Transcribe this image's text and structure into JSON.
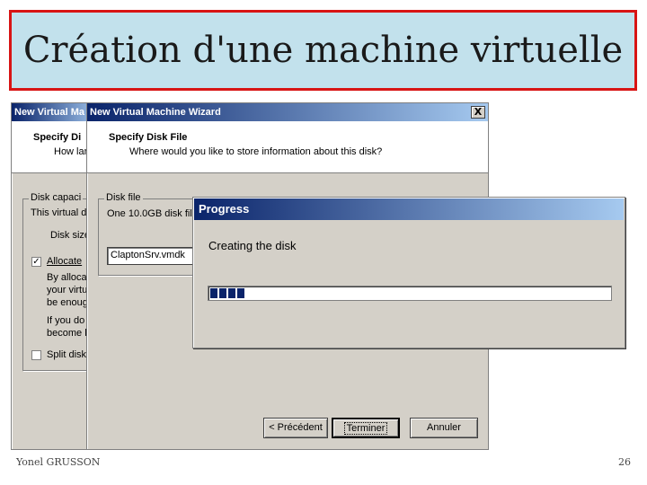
{
  "slide": {
    "title": "Création d'une machine virtuelle",
    "author": "Yonel GRUSSON",
    "page_number": "26"
  },
  "back_window": {
    "title": "New Virtual Ma",
    "header_title": "Specify Di",
    "header_subtitle": "How lar",
    "group_label": "Disk capaci",
    "group_line1": "This virtual d",
    "disk_size_label": "Disk size",
    "allocate_label": "Allocate",
    "allocate_checked": true,
    "desc1": "By alloca",
    "desc2": "your virtu",
    "desc3": "be enoug",
    "desc4": "If you do",
    "desc5": "become l",
    "split_label": "Split disk",
    "split_checked": false
  },
  "front_window": {
    "title": "New Virtual Machine Wizard",
    "close_label": "X",
    "header_title": "Specify Disk File",
    "header_subtitle": "Where would you like to store information about this disk?",
    "group_label": "Disk file",
    "group_line1": "One 10.0GB disk fil",
    "file_value": "ClaptonSrv.vmdk",
    "btn_back": "< Précédent",
    "btn_finish": "Terminer",
    "btn_cancel": "Annuler"
  },
  "progress_dialog": {
    "title": "Progress",
    "message": "Creating the disk",
    "progress": 0.1,
    "accent": "#0a246a"
  }
}
